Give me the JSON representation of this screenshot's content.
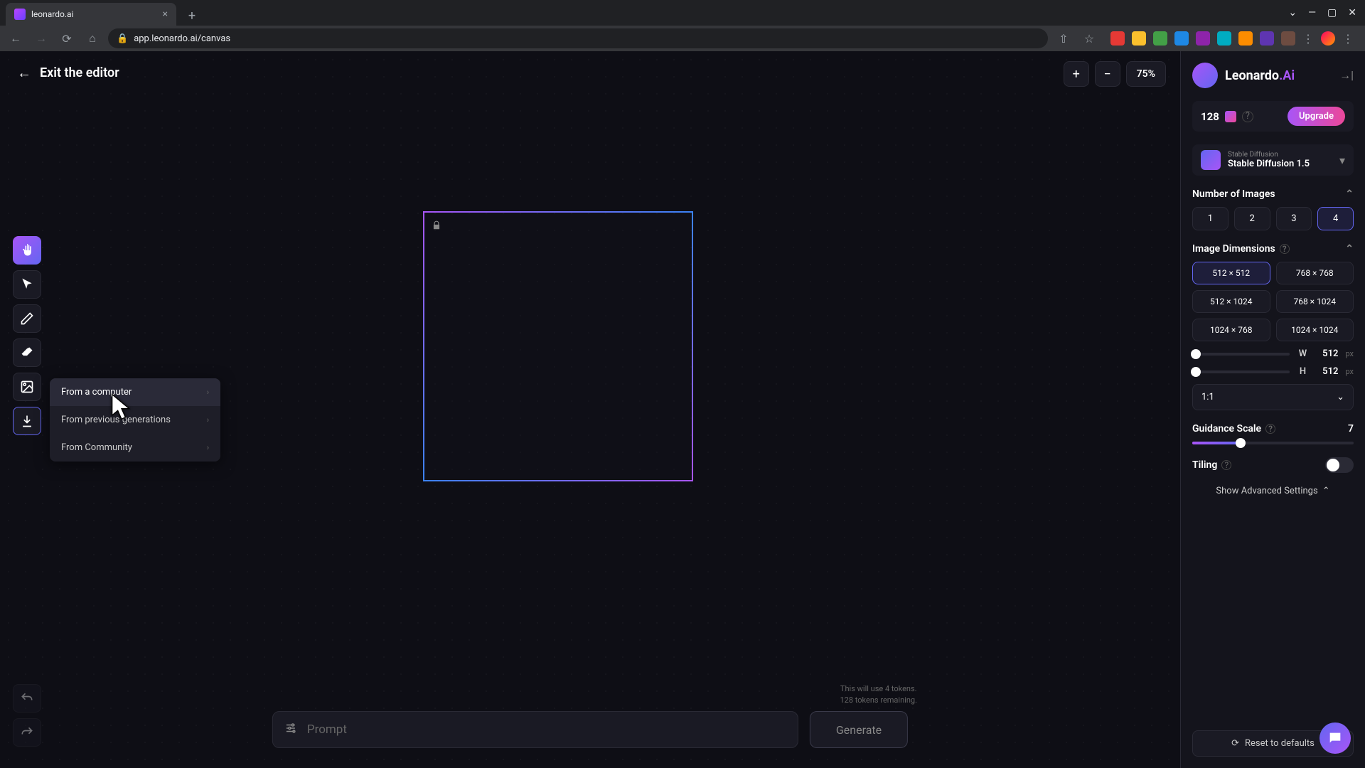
{
  "browser": {
    "tab_title": "leonardo.ai",
    "url": "app.leonardo.ai/canvas"
  },
  "header": {
    "exit_label": "Exit the editor",
    "zoom_level": "75%"
  },
  "upload_menu": {
    "items": [
      {
        "label": "From a computer"
      },
      {
        "label": "From previous generations"
      },
      {
        "label": "From Community"
      }
    ]
  },
  "prompt": {
    "placeholder": "Prompt",
    "generate_label": "Generate",
    "token_line1": "This will use 4 tokens.",
    "token_line2": "128 tokens remaining."
  },
  "panel": {
    "brand": "Leonardo",
    "brand_suffix": ".Ai",
    "credits": "128",
    "upgrade_label": "Upgrade",
    "model": {
      "sub": "Stable Diffusion",
      "name": "Stable Diffusion 1.5"
    },
    "num_images": {
      "title": "Number of Images",
      "options": [
        "1",
        "2",
        "3",
        "4"
      ],
      "selected": "4"
    },
    "dimensions": {
      "title": "Image Dimensions",
      "presets": [
        "512 × 512",
        "768 × 768",
        "512 × 1024",
        "768 × 1024",
        "1024 × 768",
        "1024 × 1024"
      ],
      "selected": "512 × 512",
      "w_label": "W",
      "w_value": "512",
      "w_unit": "px",
      "h_label": "H",
      "h_value": "512",
      "h_unit": "px",
      "ratio": "1:1"
    },
    "guidance": {
      "title": "Guidance Scale",
      "value": "7"
    },
    "tiling": {
      "title": "Tiling"
    },
    "advanced": "Show Advanced Settings",
    "reset": "Reset to defaults"
  }
}
